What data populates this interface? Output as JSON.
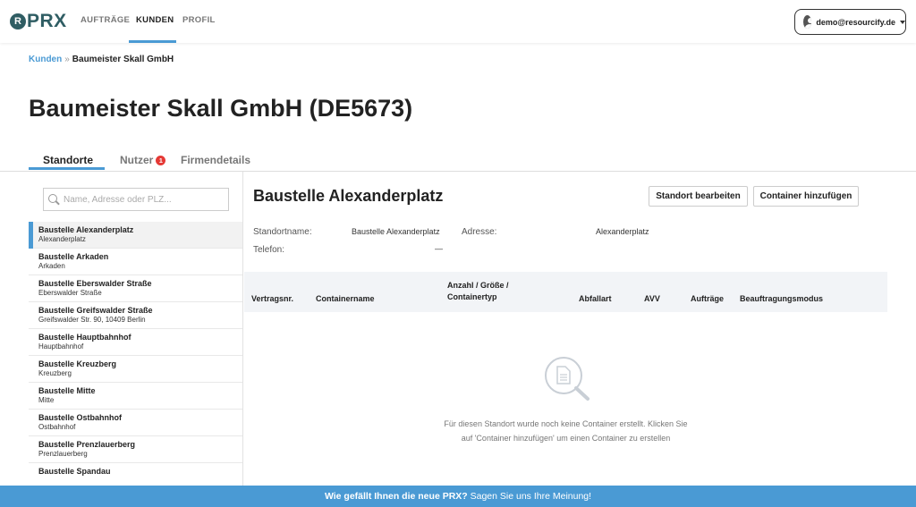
{
  "app": {
    "logo_letter": "R",
    "logo_text": "PRX"
  },
  "nav": {
    "items": [
      "AUFTRÄGE",
      "KUNDEN",
      "PROFIL"
    ],
    "active": "KUNDEN",
    "user": "demo@resourcify.de"
  },
  "breadcrumb": {
    "parent": "Kunden",
    "separator": "»",
    "current": "Baumeister Skall GmbH"
  },
  "page_title": "Baumeister Skall GmbH (DE5673)",
  "tabs": [
    {
      "label": "Standorte",
      "badge": null
    },
    {
      "label": "Nutzer",
      "badge": "1"
    },
    {
      "label": "Firmendetails",
      "badge": null
    }
  ],
  "sidebar": {
    "search_placeholder": "Name, Adresse oder PLZ...",
    "sites": [
      {
        "name": "Baustelle Alexanderplatz",
        "address": "Alexanderplatz"
      },
      {
        "name": "Baustelle Arkaden",
        "address": "Arkaden"
      },
      {
        "name": "Baustelle Eberswalder Straße",
        "address": "Eberswalder Straße"
      },
      {
        "name": "Baustelle Greifswalder Straße",
        "address": "Greifswalder Str. 90, 10409 Berlin"
      },
      {
        "name": "Baustelle Hauptbahnhof",
        "address": "Hauptbahnhof"
      },
      {
        "name": "Baustelle Kreuzberg",
        "address": "Kreuzberg"
      },
      {
        "name": "Baustelle Mitte",
        "address": "Mitte"
      },
      {
        "name": "Baustelle Ostbahnhof",
        "address": "Ostbahnhof"
      },
      {
        "name": "Baustelle Prenzlauerberg",
        "address": "Prenzlauerberg"
      },
      {
        "name": "Baustelle Spandau",
        "address": ""
      }
    ]
  },
  "detail": {
    "title": "Baustelle Alexanderplatz",
    "edit_button": "Standort bearbeiten",
    "add_button": "Container hinzufügen",
    "fields": {
      "name_label": "Standortname:",
      "name_value": "Baustelle Alexanderplatz",
      "address_label": "Adresse:",
      "address_value": "Alexanderplatz",
      "phone_label": "Telefon:",
      "phone_value": "—"
    },
    "columns": [
      "Vertragsnr.",
      "Containername",
      "Anzahl / Größe / Containertyp",
      "Abfallart",
      "AVV",
      "Aufträge",
      "Beauftragungsmodus"
    ],
    "empty_line1": "Für diesen Standort wurde noch keine Container erstellt. Klicken Sie",
    "empty_line2": "auf 'Container hinzufügen' um einen Container zu erstellen"
  },
  "footer": {
    "question": "Wie gefällt Ihnen die neue PRX?",
    "cta": "Sagen Sie uns Ihre Meinung!"
  },
  "colors": {
    "accent": "#4a9ad4",
    "brand": "#2f5d63",
    "badge": "#e53935"
  }
}
